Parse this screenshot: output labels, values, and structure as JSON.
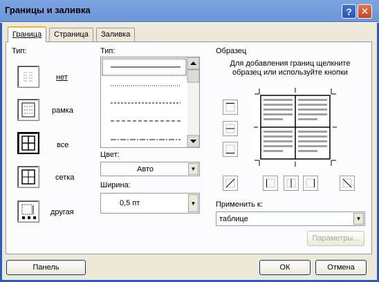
{
  "window": {
    "title": "Границы и заливка"
  },
  "tabs": [
    {
      "label": "Граница",
      "active": true
    },
    {
      "label": "Страница",
      "active": false
    },
    {
      "label": "Заливка",
      "active": false
    }
  ],
  "setting": {
    "label": "Тип:",
    "options": [
      {
        "label": "нет",
        "icon": "border-none-icon"
      },
      {
        "label": "рамка",
        "icon": "border-box-icon"
      },
      {
        "label": "все",
        "icon": "border-all-icon",
        "selected": true
      },
      {
        "label": "сетка",
        "icon": "border-grid-icon"
      },
      {
        "label": "другая",
        "icon": "border-custom-icon"
      }
    ]
  },
  "style": {
    "label": "Тип:",
    "color_label": "Цвет:",
    "color_value": "Авто",
    "width_label": "Ширина:",
    "width_value": "0,5 пт"
  },
  "preview": {
    "title": "Образец",
    "hint": "Для добавления границ щелкните образец или используйте кнопки",
    "apply_label": "Применить к:",
    "apply_value": "таблице",
    "options_button": "Параметры..."
  },
  "footer": {
    "panel_button": "Панель",
    "ok_button": "ОК",
    "cancel_button": "Отмена"
  },
  "colors": {
    "titlebar": "#7ba4e0",
    "dialog_bg": "#ece9d8",
    "tab_accent": "#f1b82f"
  }
}
